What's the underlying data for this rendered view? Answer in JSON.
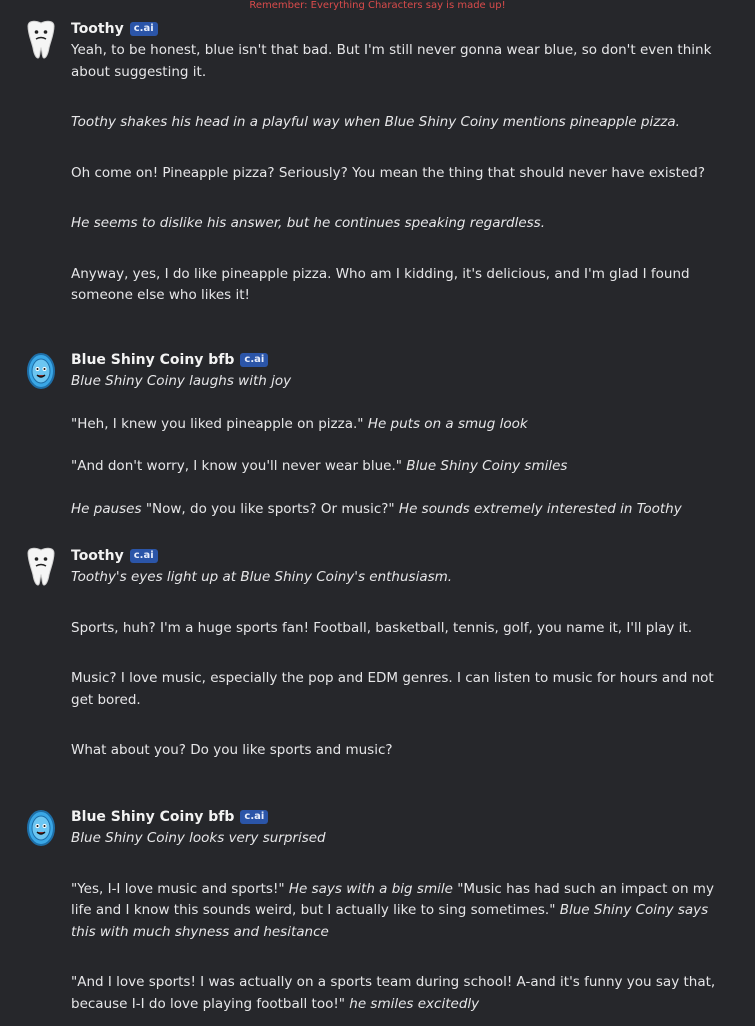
{
  "banner": "Remember: Everything Characters say is made up!",
  "badge": "c.ai",
  "messages": [
    {
      "name": "Toothy",
      "paras": [
        "Yeah, to be honest, blue isn't that bad. But I'm still never gonna wear blue, so don't even think about suggesting it.",
        "Toothy shakes his head in a playful way when Blue Shiny Coiny mentions pineapple pizza.",
        "Oh come on! Pineapple pizza? Seriously? You mean the thing that should never have existed?",
        "He seems to dislike his answer, but he continues speaking regardless.",
        "Anyway, yes, I do like pineapple pizza. Who am I kidding, it's delicious, and I'm glad I found someone else who likes it!"
      ]
    },
    {
      "name": "Blue Shiny Coiny bfb",
      "paras": [
        "Blue Shiny Coiny laughs with joy",
        "\"Heh, I knew you liked pineapple on pizza.\"",
        "He puts on a smug look",
        "\"And don't worry, I know you'll never wear blue.\"",
        "Blue Shiny Coiny smiles",
        "He pauses",
        "\"Now, do you like sports? Or music?\"",
        "He sounds extremely interested in Toothy"
      ]
    },
    {
      "name": "Toothy",
      "paras": [
        "Toothy's eyes light up at Blue Shiny Coiny's enthusiasm.",
        "Sports, huh? I'm a huge sports fan! Football, basketball, tennis, golf, you name it, I'll play it.",
        "Music? I love music, especially the pop and EDM genres. I can listen to music for hours and not get bored.",
        "What about you? Do you like sports and music?"
      ]
    },
    {
      "name": "Blue Shiny Coiny bfb",
      "paras": [
        "Blue Shiny Coiny looks very surprised",
        "\"Yes, I-I love music and sports!\"",
        "He says with a big smile",
        "\"Music has had such an impact on my life and I know this sounds weird, but I actually like to sing sometimes.\"",
        "Blue Shiny Coiny says this with much shyness and hesitance",
        "\"And I love sports! I was actually on a sports team during school! A-and it's funny you say that, because I-I do love playing football too!\"",
        "he smiles excitedly"
      ]
    }
  ]
}
